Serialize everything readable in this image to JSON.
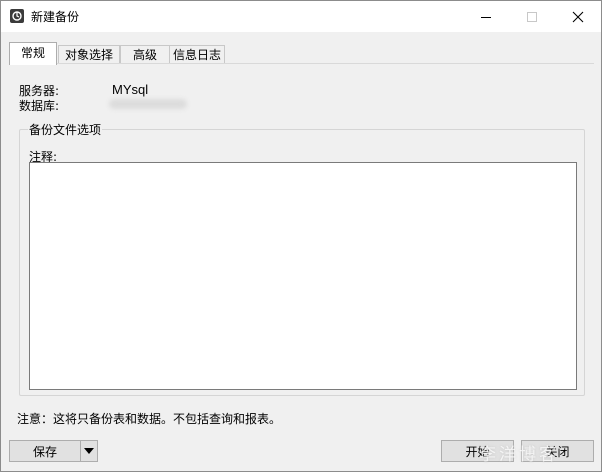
{
  "window": {
    "title": "新建备份",
    "icon": "backup-app-icon",
    "controls": [
      "minimize-icon",
      "maximize-icon",
      "close-icon"
    ]
  },
  "tabs": [
    {
      "label": "常规",
      "active": true
    },
    {
      "label": "对象选择",
      "active": false
    },
    {
      "label": "高级",
      "active": false
    },
    {
      "label": "信息日志",
      "active": false
    }
  ],
  "general": {
    "server_label": "服务器:",
    "server_value": "MYsql",
    "database_label": "数据库:",
    "groupbox_title": "备份文件选项",
    "notes_label": "注释:",
    "notes_value": "",
    "footnote": "注意：这将只备份表和数据。不包括查询和报表。"
  },
  "buttons": {
    "save": "保存",
    "save_dropdown_icon": "triangle-down-icon",
    "start": "开始",
    "close": "关闭"
  },
  "watermark": "李洋博客"
}
